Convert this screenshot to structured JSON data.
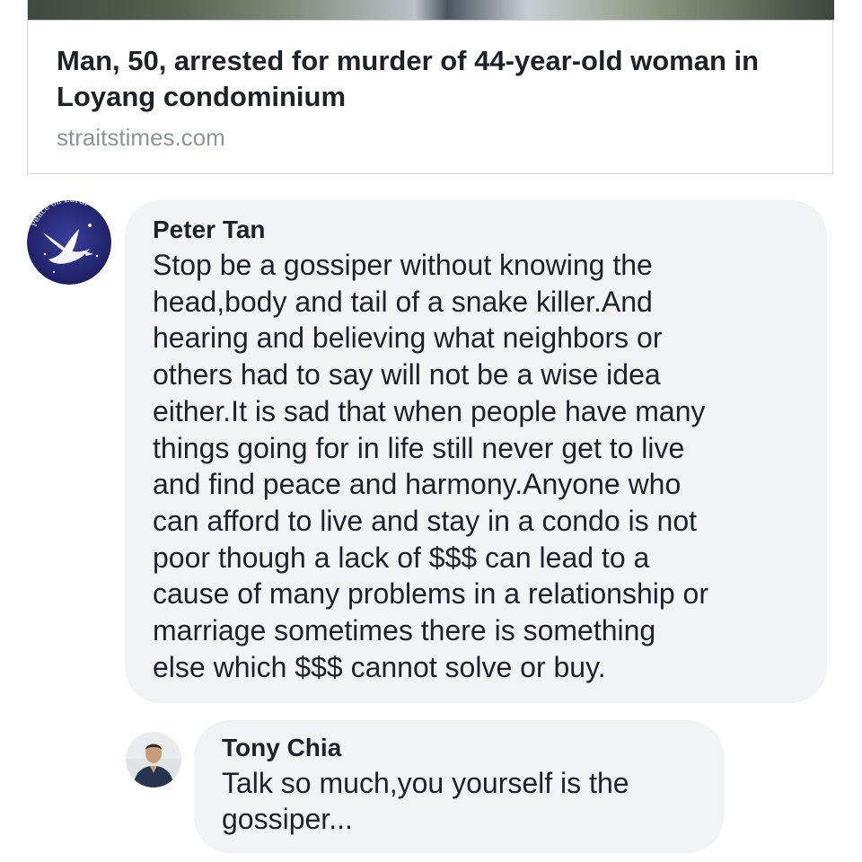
{
  "link_preview": {
    "title": "Man, 50, arrested for murder of 44-year-old woman in Loyang condominium",
    "domain": "straitstimes.com"
  },
  "comments": [
    {
      "author": "Peter Tan",
      "avatar_icon": "dove-peace-avatar",
      "avatar_text": "Peace on Earth",
      "text": "Stop be a gossiper without knowing the\nhead,body and tail of a snake killer.And\nhearing and believing what neighbors or\nothers had to say will not be a wise idea\neither.It is sad that when people have many\nthings going for in life still never get to live\nand find peace and harmony.Anyone who\ncan afford to live and stay in a condo is not\npoor though a lack of $$$ can lead to a\ncause of many problems in a relationship or\nmarriage sometimes there is something\nelse which $$$ cannot solve or buy."
    },
    {
      "author": "Tony Chia",
      "avatar_icon": "person-photo-avatar",
      "text": "Talk so much,you yourself is the\ngossiper..."
    }
  ],
  "colors": {
    "bubble_bg": "#f2f3f5",
    "text": "#1d2129",
    "secondary_text": "#8d949e",
    "card_border": "#d5d7db"
  }
}
